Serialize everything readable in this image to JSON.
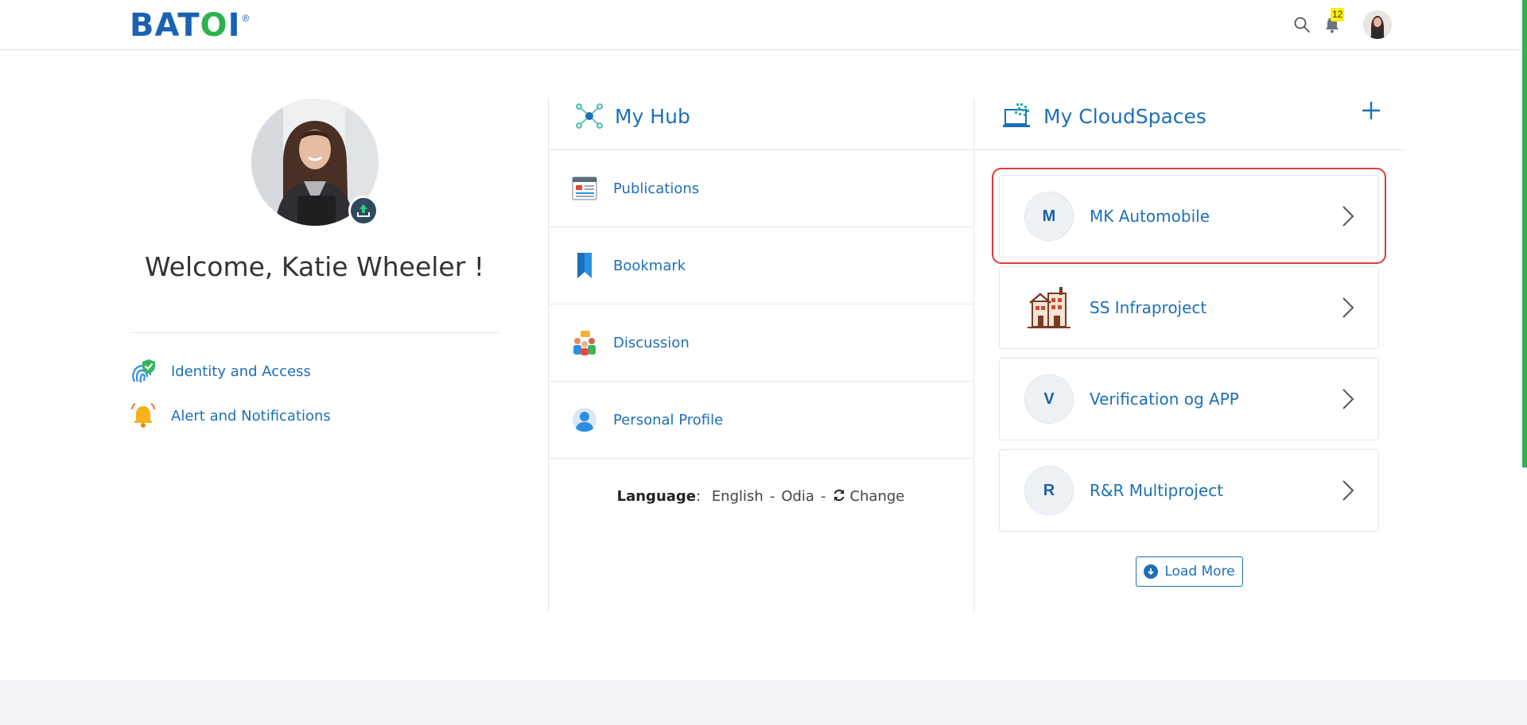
{
  "header": {
    "logo_text_1": "BAT",
    "logo_text_2": "O",
    "logo_text_3": "I",
    "logo_reg": "®",
    "notification_count": "12"
  },
  "profile": {
    "welcome": "Welcome, Katie Wheeler !",
    "links": [
      {
        "label": "Identity and Access",
        "icon": "fingerprint-shield-icon"
      },
      {
        "label": "Alert and Notifications",
        "icon": "bell-alert-icon"
      }
    ]
  },
  "hub": {
    "title": "My Hub",
    "items": [
      {
        "label": "Publications",
        "icon": "publications-icon"
      },
      {
        "label": "Bookmark",
        "icon": "bookmark-icon"
      },
      {
        "label": "Discussion",
        "icon": "discussion-icon"
      },
      {
        "label": "Personal Profile",
        "icon": "person-icon"
      }
    ],
    "language": {
      "label": "Language",
      "colon": ":",
      "options": [
        "English",
        "Odia"
      ],
      "change": "Change"
    }
  },
  "cloud": {
    "title": "My CloudSpaces",
    "spaces": [
      {
        "initial": "M",
        "name": "MK Automobile"
      },
      {
        "initial": "",
        "name": "SS Infraproject",
        "icon": "building-icon"
      },
      {
        "initial": "V",
        "name": "Verification og APP"
      },
      {
        "initial": "R",
        "name": "R&R Multiproject"
      }
    ],
    "load_more": "Load More"
  },
  "colors": {
    "brand_blue": "#1d6fb8",
    "brand_green": "#2cb24f",
    "highlight_red": "#e03a3e",
    "badge_yellow": "#fff200"
  }
}
